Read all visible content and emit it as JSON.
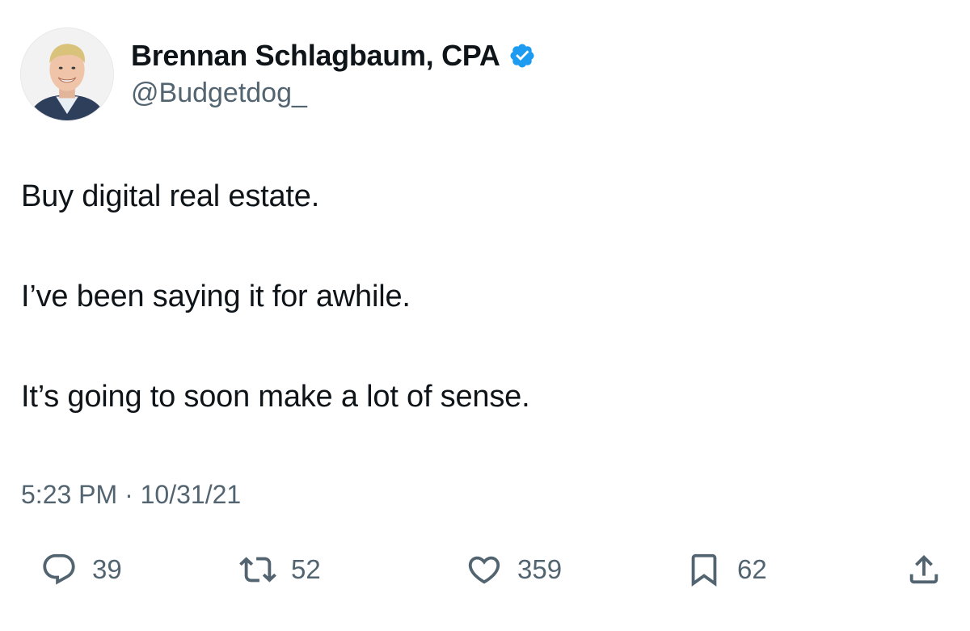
{
  "author": {
    "display_name": "Brennan Schlagbaum, CPA",
    "handle": "@Budgetdog_",
    "verified": true,
    "verified_color": "#1d9bf0"
  },
  "tweet": {
    "lines": [
      "Buy digital real estate.",
      "I’ve been saying it for awhile.",
      "It’s going to soon make a lot of sense."
    ],
    "timestamp": "5:23 PM · 10/31/21"
  },
  "actions": {
    "reply": {
      "icon": "reply-icon",
      "count": "39"
    },
    "retweet": {
      "icon": "retweet-icon",
      "count": "52"
    },
    "like": {
      "icon": "heart-icon",
      "count": "359"
    },
    "bookmark": {
      "icon": "bookmark-icon",
      "count": "62"
    },
    "share": {
      "icon": "share-icon"
    }
  },
  "colors": {
    "text_primary": "#0f1419",
    "text_secondary": "#536471",
    "icon_color": "#536471"
  }
}
